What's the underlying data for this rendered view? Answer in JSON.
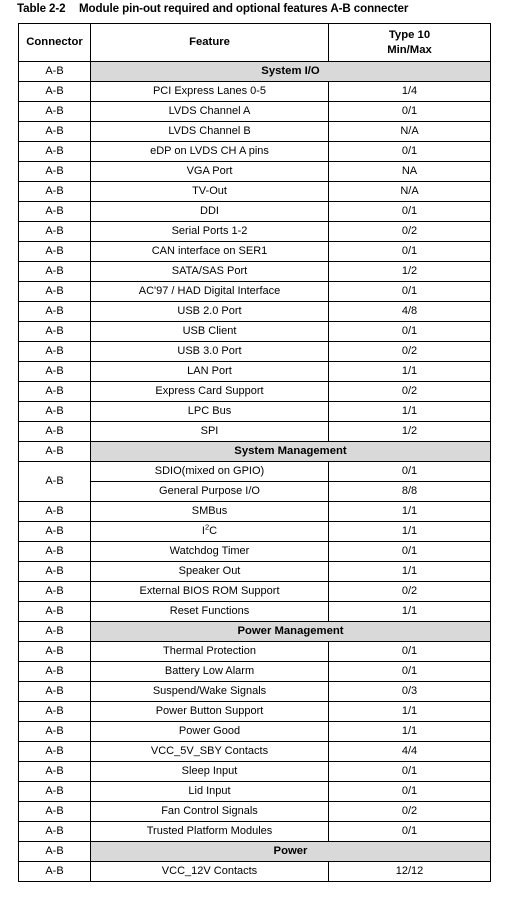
{
  "caption": {
    "number": "Table 2-2",
    "title": "Module pin-out required and optional features A-B connecter"
  },
  "colors": {
    "section_shading": "#d9d9d9",
    "border": "#000000",
    "text": "#000000"
  },
  "table": {
    "headers": {
      "connector": "Connector",
      "feature": "Feature",
      "type_line1": "Type 10",
      "type_line2": "Min/Max"
    },
    "connector_value": "A-B",
    "rows": [
      {
        "kind": "section",
        "connector": "A-B",
        "title": "System I/O"
      },
      {
        "kind": "data",
        "connector": "A-B",
        "feature": "PCI Express Lanes 0-5",
        "type": "1/4"
      },
      {
        "kind": "data",
        "connector": "A-B",
        "feature": "LVDS Channel A",
        "type": "0/1"
      },
      {
        "kind": "data",
        "connector": "A-B",
        "feature": "LVDS Channel B",
        "type": "N/A"
      },
      {
        "kind": "data",
        "connector": "A-B",
        "feature": "eDP on LVDS CH A pins",
        "type": "0/1"
      },
      {
        "kind": "data",
        "connector": "A-B",
        "feature": "VGA Port",
        "type": "NA"
      },
      {
        "kind": "data",
        "connector": "A-B",
        "feature": "TV-Out",
        "type": "N/A"
      },
      {
        "kind": "data",
        "connector": "A-B",
        "feature": "DDI",
        "type": "0/1"
      },
      {
        "kind": "data",
        "connector": "A-B",
        "feature": "Serial Ports 1-2",
        "type": "0/2"
      },
      {
        "kind": "data",
        "connector": "A-B",
        "feature": "CAN interface on SER1",
        "type": "0/1"
      },
      {
        "kind": "data",
        "connector": "A-B",
        "feature": "SATA/SAS Port",
        "type": "1/2"
      },
      {
        "kind": "data",
        "connector": "A-B",
        "feature": "AC'97 / HAD Digital Interface",
        "type": "0/1"
      },
      {
        "kind": "data",
        "connector": "A-B",
        "feature": "USB 2.0 Port",
        "type": "4/8"
      },
      {
        "kind": "data",
        "connector": "A-B",
        "feature": "USB Client",
        "type": "0/1"
      },
      {
        "kind": "data",
        "connector": "A-B",
        "feature": "USB 3.0 Port",
        "type": "0/2"
      },
      {
        "kind": "data",
        "connector": "A-B",
        "feature": "LAN Port",
        "type": "1/1"
      },
      {
        "kind": "data",
        "connector": "A-B",
        "feature": "Express Card Support",
        "type": "0/2"
      },
      {
        "kind": "data",
        "connector": "A-B",
        "feature": "LPC Bus",
        "type": "1/1"
      },
      {
        "kind": "data",
        "connector": "A-B",
        "feature": "SPI",
        "type": "1/2"
      },
      {
        "kind": "section",
        "connector": "A-B",
        "title": "System Management"
      },
      {
        "kind": "data",
        "connector": "A-B",
        "connector_rowspan": 2,
        "feature": "SDIO(mixed on GPIO)",
        "type": "0/1"
      },
      {
        "kind": "data",
        "connector": null,
        "feature": "General Purpose I/O",
        "type": "8/8"
      },
      {
        "kind": "data",
        "connector": "A-B",
        "feature": "SMBus",
        "type": "1/1"
      },
      {
        "kind": "data",
        "connector": "A-B",
        "feature": "I²C",
        "feature_html": "I<sup>2</sup>C",
        "type": "1/1"
      },
      {
        "kind": "data",
        "connector": "A-B",
        "feature": "Watchdog Timer",
        "type": "0/1"
      },
      {
        "kind": "data",
        "connector": "A-B",
        "feature": "Speaker Out",
        "type": "1/1"
      },
      {
        "kind": "data",
        "connector": "A-B",
        "feature": "External BIOS ROM Support",
        "type": "0/2"
      },
      {
        "kind": "data",
        "connector": "A-B",
        "feature": "Reset Functions",
        "type": "1/1"
      },
      {
        "kind": "section",
        "connector": "A-B",
        "title": "Power Management"
      },
      {
        "kind": "data",
        "connector": "A-B",
        "feature": "Thermal Protection",
        "type": "0/1"
      },
      {
        "kind": "data",
        "connector": "A-B",
        "feature": "Battery Low Alarm",
        "type": "0/1"
      },
      {
        "kind": "data",
        "connector": "A-B",
        "feature": "Suspend/Wake Signals",
        "type": "0/3"
      },
      {
        "kind": "data",
        "connector": "A-B",
        "feature": "Power Button Support",
        "type": "1/1"
      },
      {
        "kind": "data",
        "connector": "A-B",
        "feature": "Power Good",
        "type": "1/1"
      },
      {
        "kind": "data",
        "connector": "A-B",
        "feature": "VCC_5V_SBY Contacts",
        "type": "4/4"
      },
      {
        "kind": "data",
        "connector": "A-B",
        "feature": "Sleep Input",
        "type": "0/1"
      },
      {
        "kind": "data",
        "connector": "A-B",
        "feature": "Lid Input",
        "type": "0/1"
      },
      {
        "kind": "data",
        "connector": "A-B",
        "feature": "Fan Control Signals",
        "type": "0/2"
      },
      {
        "kind": "data",
        "connector": "A-B",
        "feature": "Trusted Platform Modules",
        "type": "0/1"
      },
      {
        "kind": "section",
        "connector": "A-B",
        "title": "Power"
      },
      {
        "kind": "data",
        "connector": "A-B",
        "feature": "VCC_12V Contacts",
        "type": "12/12"
      }
    ]
  }
}
